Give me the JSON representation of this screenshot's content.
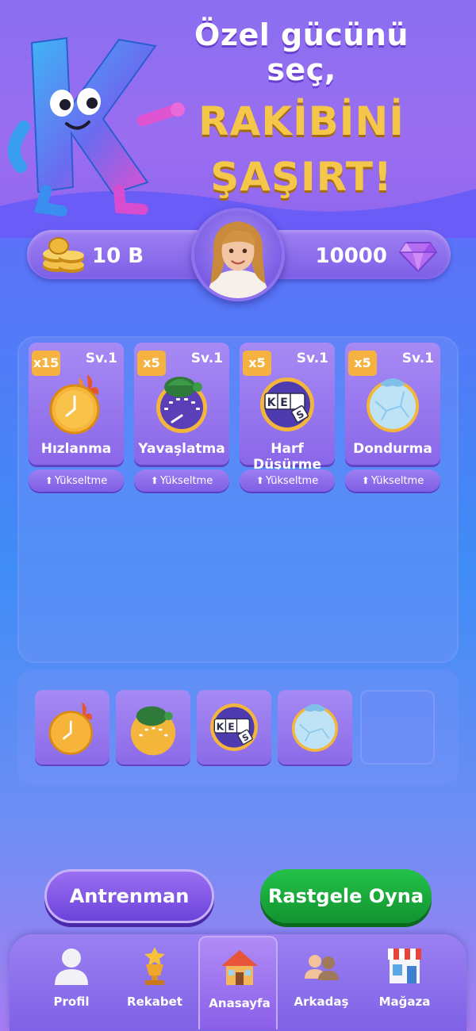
{
  "header": {
    "line1": "Özel gücünü seç,",
    "line2": "RAKİBİNİ",
    "line3": "ŞAŞIRT!",
    "mascot_letter": "K"
  },
  "currency": {
    "coins": "10 B",
    "gems": "10000",
    "coins_icon": "coin-stack-icon",
    "gems_icon": "diamond-icon"
  },
  "powers": [
    {
      "count": "x15",
      "level": "Sv.1",
      "name": "Hızlanma",
      "icon": "flaming-clock-icon",
      "upgrade": "Yükseltme"
    },
    {
      "count": "x5",
      "level": "Sv.1",
      "name": "Yavaşlatma",
      "icon": "turtle-gauge-icon",
      "upgrade": "Yükseltme"
    },
    {
      "count": "x5",
      "level": "Sv.1",
      "name": "Harf Düşürme",
      "icon": "letter-tiles-icon",
      "upgrade": "Yükseltme"
    },
    {
      "count": "x5",
      "level": "Sv.1",
      "name": "Dondurma",
      "icon": "ice-orb-icon",
      "upgrade": "Yükseltme"
    }
  ],
  "tile_letters": [
    "K",
    "E",
    "S"
  ],
  "actions": {
    "training": "Antrenman",
    "random_play": "Rastgele Oyna"
  },
  "nav": [
    {
      "label": "Profil",
      "icon": "profile-icon"
    },
    {
      "label": "Rekabet",
      "icon": "trophy-icon"
    },
    {
      "label": "Anasayfa",
      "icon": "home-icon",
      "active": true
    },
    {
      "label": "Arkadaş",
      "icon": "friends-icon"
    },
    {
      "label": "Mağaza",
      "icon": "store-icon"
    }
  ],
  "colors": {
    "accent_purple": "#8a67e8",
    "gold": "#f4c64a",
    "badge_orange": "#f6b240",
    "play_green": "#12932f"
  }
}
